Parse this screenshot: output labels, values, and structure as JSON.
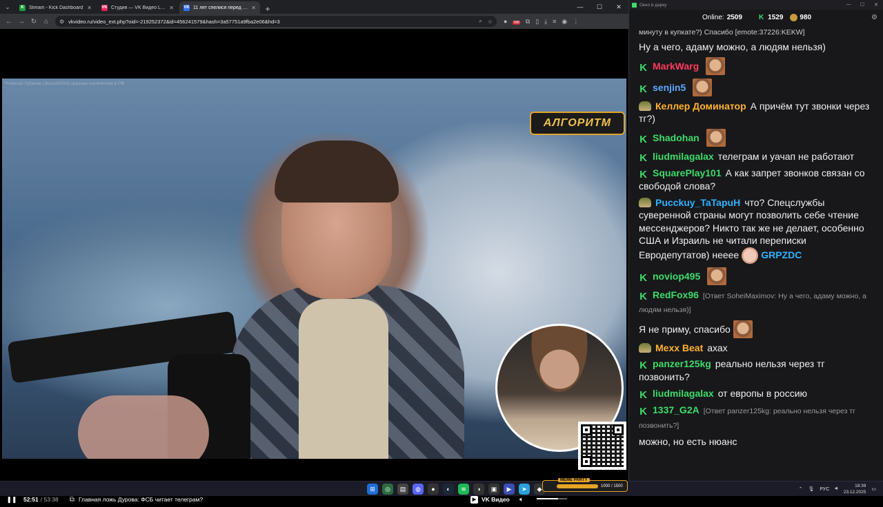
{
  "browser": {
    "tabs": [
      {
        "title": "Stream - Kick Dashboard",
        "favicon": "K",
        "color": "#1e9e3a",
        "active": false
      },
      {
        "title": "Студия — VK Видео Live",
        "favicon": "VK",
        "color": "#e0245e",
        "active": false
      },
      {
        "title": "11 лет спелися перед Украин...",
        "favicon": "VK",
        "color": "#2f6fff",
        "active": true
      }
    ],
    "url": "vkvideo.ru/video_ext.php?oid=-219252372&id=456241579&hash=3a57751a9fba2e06&hd=3",
    "ext_badge": "588"
  },
  "video": {
    "foreign_agent_note": "*Алексей Губанов (JesusAVGN) признан иноагентом в РФ",
    "logo_text": "АЛГОРИТМ",
    "current_time": "52:51",
    "duration": "/ 53:38",
    "chapter_title": "Главная ложь Дурова: ФСБ читает телеграм?",
    "brand": "VK Видео",
    "progress": 0.985,
    "volume": 0.7
  },
  "chat": {
    "window_title": "Окно в дарку",
    "online_label": "Online:",
    "online_count": "2509",
    "kick_count": "1529",
    "coins_count": "980",
    "messages": [
      {
        "type": "top",
        "text": "минуту в купкате?) Спасибо [emote:37226:KEKW]"
      },
      {
        "type": "plain",
        "text": "Ну а чего, адаму можно, а людям нельзя)"
      },
      {
        "type": "kick",
        "user": "MarkWarg",
        "color": "#ff3b5c",
        "text": "",
        "emote": "face"
      },
      {
        "type": "kick",
        "user": "senjin5",
        "color": "#5fa8ff",
        "text": "",
        "emote": "face"
      },
      {
        "type": "avatar",
        "user": "Келлер Доминатор",
        "color": "#ffb22e",
        "text": "А причём тут звонки через тг?)"
      },
      {
        "type": "kick",
        "user": "Shadohan",
        "color": "#3ddc6a",
        "text": "",
        "emote": "face"
      },
      {
        "type": "kick",
        "user": "liudmilagalax",
        "color": "#3ddc6a",
        "text": "телеграм и уачап не работают"
      },
      {
        "type": "kick",
        "user": "SquarePlay101",
        "color": "#3ddc6a",
        "text": "А как запрет звонков связан со свободой слова?"
      },
      {
        "type": "avatar",
        "user": "Pucckuy_TaTapuH",
        "color": "#2fb3ff",
        "text": "что? Спецслужбы суверенной страны могут позволить себе чтение мессенджеров? Никто так же не делает, особенно США и Израиль не читали переписки Евродепутатов) нееее",
        "emote": "pale",
        "suffix": "GRPZDC"
      },
      {
        "type": "kick",
        "user": "noviop495",
        "color": "#3ddc6a",
        "text": "",
        "emote": "face"
      },
      {
        "type": "kick",
        "user": "RedFox96",
        "color": "#3ddc6a",
        "reply": "[Ответ SoheiMaximov: Ну а чего, адаму можно, а людям нельзя)]"
      },
      {
        "type": "plain",
        "text": "Я не приму, спасибо",
        "emote": "face"
      },
      {
        "type": "avatar",
        "user": "Mexx Beat",
        "color": "#ffb22e",
        "text": "ахах"
      },
      {
        "type": "kick",
        "user": "panzer125kg",
        "color": "#3ddc6a",
        "text": "реально нельзя через тг позвонить?"
      },
      {
        "type": "kick",
        "user": "liudmilagalax",
        "color": "#3ddc6a",
        "text": "от европы в россию"
      },
      {
        "type": "kick",
        "user": "1337_G2A",
        "color": "#3ddc6a",
        "reply": "[Ответ panzer125kg: реально нельзя через тг позвонить?]"
      },
      {
        "type": "plain",
        "text": "можно, но есть нюанс"
      }
    ]
  },
  "taskbar": {
    "meme_title": "MEME PARTY",
    "meme_value": "1000 / 1500",
    "lang": "РУС",
    "time": "18:39",
    "date": "23.12.2025"
  }
}
